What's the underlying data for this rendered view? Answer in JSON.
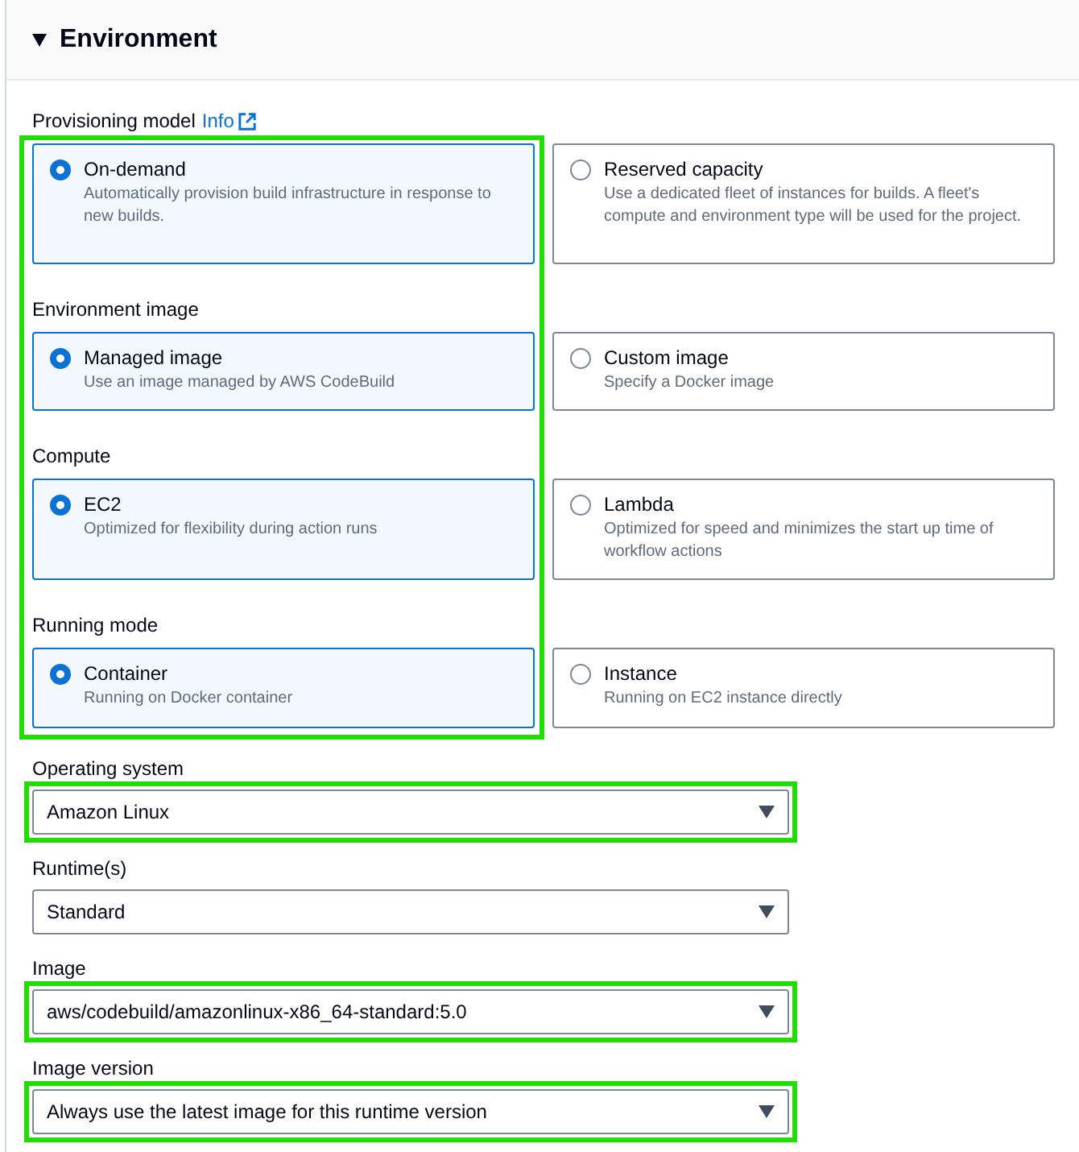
{
  "panel": {
    "title": "Environment",
    "expanded": true
  },
  "radio_groups_highlighted": true,
  "radio_groups": [
    {
      "label": "Provisioning model",
      "info_link": "Info",
      "options": [
        {
          "title": "On-demand",
          "description": "Automatically provision build infrastructure in response to new builds.",
          "selected": true
        },
        {
          "title": "Reserved capacity",
          "description": "Use a dedicated fleet of instances for builds. A fleet's compute and environment type will be used for the project.",
          "selected": false
        }
      ]
    },
    {
      "label": "Environment image",
      "options": [
        {
          "title": "Managed image",
          "description": "Use an image managed by AWS CodeBuild",
          "selected": true
        },
        {
          "title": "Custom image",
          "description": "Specify a Docker image",
          "selected": false
        }
      ]
    },
    {
      "label": "Compute",
      "options": [
        {
          "title": "EC2",
          "description": "Optimized for flexibility during action runs",
          "selected": true
        },
        {
          "title": "Lambda",
          "description": "Optimized for speed and minimizes the start up time of workflow actions",
          "selected": false
        }
      ]
    },
    {
      "label": "Running mode",
      "options": [
        {
          "title": "Container",
          "description": "Running on Docker container",
          "selected": true
        },
        {
          "title": "Instance",
          "description": "Running on EC2 instance directly",
          "selected": false
        }
      ]
    }
  ],
  "selects": [
    {
      "label": "Operating system",
      "value": "Amazon Linux",
      "highlighted": true
    },
    {
      "label": "Runtime(s)",
      "value": "Standard",
      "highlighted": false
    },
    {
      "label": "Image",
      "value": "aws/codebuild/amazonlinux-x86_64-standard:5.0",
      "highlighted": true
    },
    {
      "label": "Image version",
      "value": "Always use the latest image for this runtime version",
      "highlighted": true
    }
  ]
}
